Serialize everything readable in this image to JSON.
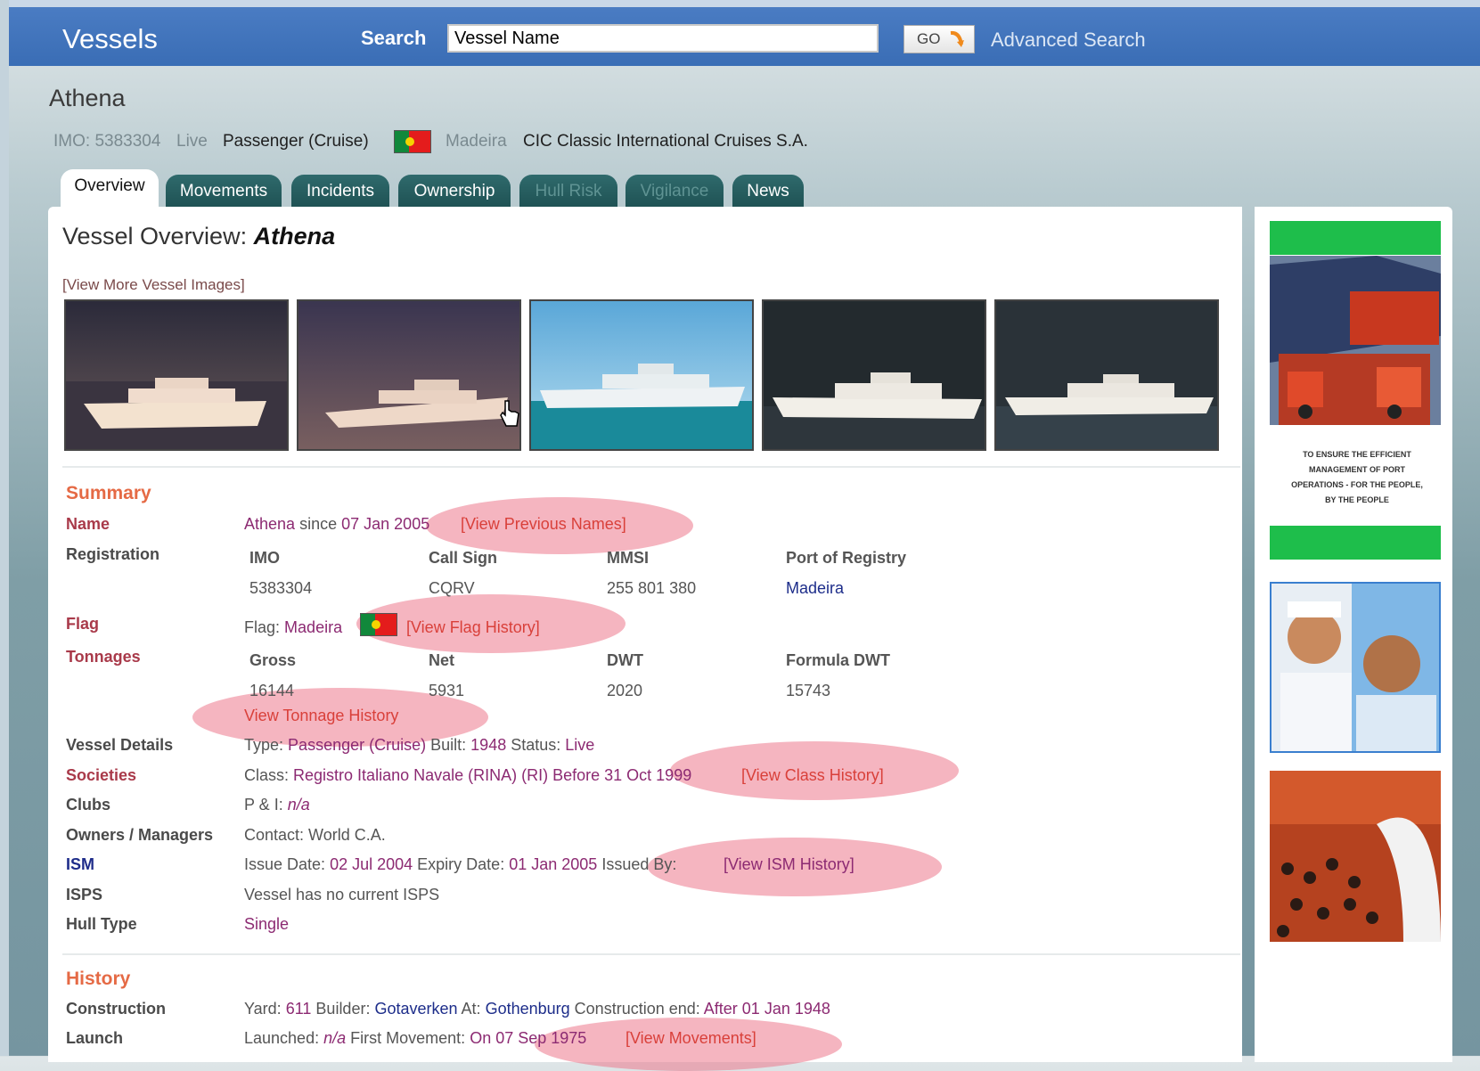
{
  "header": {
    "brand": "Vessels",
    "search_label": "Search",
    "search_value": "Vessel Name",
    "go_label": "GO",
    "advanced_search": "Advanced Search"
  },
  "vessel": {
    "name": "Athena",
    "imo": "IMO: 5383304",
    "status": "Live",
    "type": "Passenger (Cruise)",
    "flag_name": "Madeira",
    "owner": "CIC Classic International Cruises S.A."
  },
  "tabs": [
    {
      "label": "Overview",
      "state": "active"
    },
    {
      "label": "Movements",
      "state": "enabled"
    },
    {
      "label": "Incidents",
      "state": "enabled"
    },
    {
      "label": "Ownership",
      "state": "enabled"
    },
    {
      "label": "Hull Risk",
      "state": "disabled"
    },
    {
      "label": "Vigilance",
      "state": "disabled"
    },
    {
      "label": "News",
      "state": "enabled"
    }
  ],
  "overview": {
    "title_prefix": "Vessel Overview:",
    "title_name": "Athena",
    "more_images": "[View More Vessel Images]"
  },
  "summary": {
    "title": "Summary",
    "name_label": "Name",
    "name_value": "Athena",
    "name_since": "since",
    "name_date": "07 Jan 2005",
    "name_link": "[View Previous Names]",
    "registration_label": "Registration",
    "reg_headers": [
      "IMO",
      "Call Sign",
      "MMSI",
      "Port of Registry"
    ],
    "reg_values": [
      "5383304",
      "CQRV",
      "255 801 380",
      "Madeira"
    ],
    "flag_label": "Flag",
    "flag_prefix": "Flag:",
    "flag_value": "Madeira",
    "flag_link": "[View Flag History]",
    "tonnages_label": "Tonnages",
    "ton_headers": [
      "Gross",
      "Net",
      "DWT",
      "Formula DWT"
    ],
    "ton_values": [
      "16144",
      "5931",
      "2020",
      "15743"
    ],
    "ton_link": "View Tonnage History",
    "details_label": "Vessel Details",
    "details_type_prefix": "Type:",
    "details_type": "Passenger (Cruise)",
    "details_built_prefix": "Built:",
    "details_built": "1948",
    "details_status_prefix": "Status:",
    "details_status": "Live",
    "societies_label": "Societies",
    "class_prefix": "Class:",
    "class_value": "Registro Italiano Navale (RINA) (RI) Before 31 Oct 1999",
    "class_link": "[View Class History]",
    "clubs_label": "Clubs",
    "clubs_prefix": "P & I:",
    "clubs_value": "n/a",
    "owners_label": "Owners / Managers",
    "owners_value": "Contact: World C.A.",
    "ism_label": "ISM",
    "ism_issue_prefix": "Issue Date:",
    "ism_issue": "02 Jul 2004",
    "ism_expiry_prefix": "Expiry Date:",
    "ism_expiry": "01 Jan 2005",
    "ism_issued_by": "Issued By:",
    "ism_link": "[View ISM History]",
    "isps_label": "ISPS",
    "isps_value": "Vessel has no current ISPS",
    "hull_label": "Hull Type",
    "hull_value": "Single"
  },
  "history": {
    "title": "History",
    "construction_label": "Construction",
    "yard_prefix": "Yard:",
    "yard": "611",
    "builder_prefix": "Builder:",
    "builder": "Gotaverken",
    "at_prefix": "At:",
    "at": "Gothenburg",
    "end_prefix": "Construction end:",
    "end": "After 01 Jan 1948",
    "launch_label": "Launch",
    "launched_prefix": "Launched:",
    "launched": "n/a",
    "first_move_prefix": "First Movement:",
    "first_move": "On 07 Sep 1975",
    "movements_link": "[View Movements]"
  },
  "sidebar": {
    "ad_text": "TO ENSURE THE EFFICIENT MANAGEMENT OF PORT OPERATIONS - FOR THE PEOPLE, BY THE PEOPLE"
  },
  "colors": {
    "header_blue": "#3a6db5",
    "tab_teal": "#1f5254",
    "section_orange": "#e56a45",
    "link_purple": "#8c2a72",
    "highlight_pink": "#ec788c",
    "ad_green": "#1ebe4b"
  }
}
